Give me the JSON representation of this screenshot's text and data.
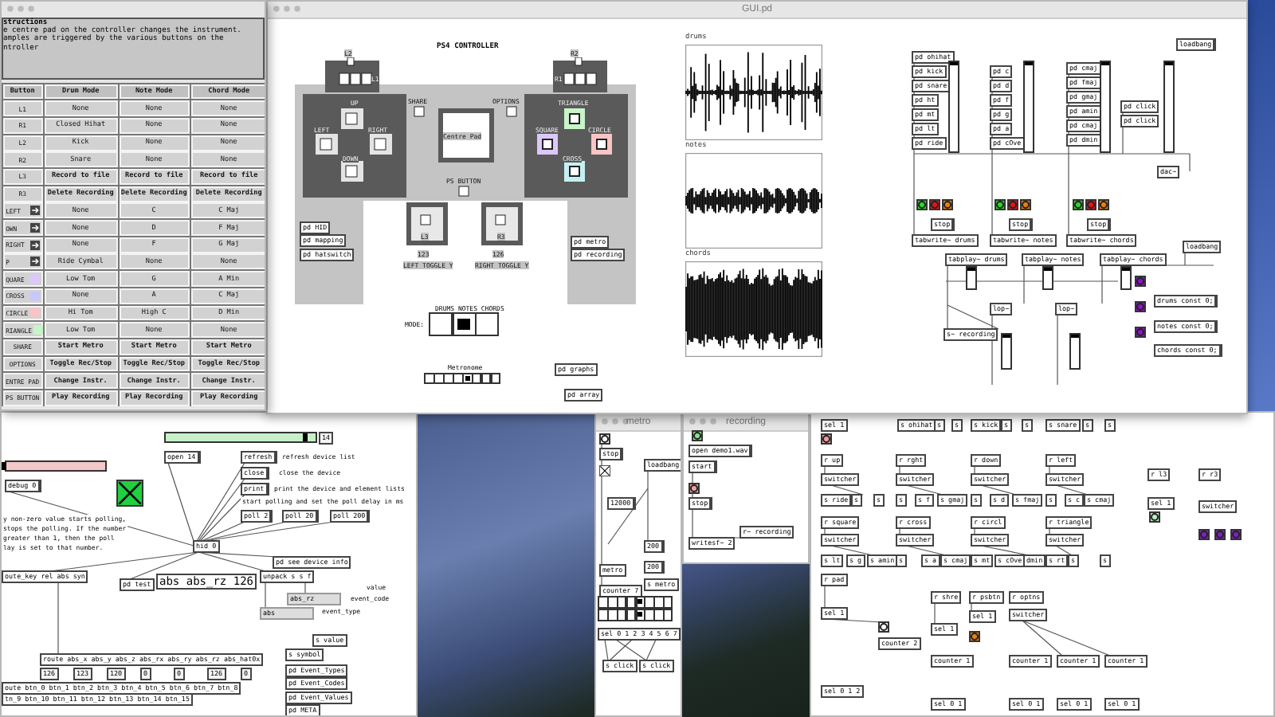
{
  "instructions": {
    "title": "structions",
    "text": [
      "e centre pad on the controller changes the instrument.",
      "amples are triggered by the various buttons on the",
      "ntroller"
    ],
    "columns": [
      "Button",
      "Drum Mode",
      "Note Mode",
      "Chord Mode"
    ],
    "rows": [
      {
        "kind": "plain",
        "bold": false,
        "cells": [
          "L1",
          "None",
          "None",
          "None"
        ]
      },
      {
        "kind": "plain",
        "bold": false,
        "cells": [
          "R1",
          "Closed Hihat",
          "None",
          "None"
        ]
      },
      {
        "kind": "plain",
        "bold": false,
        "cells": [
          "L2",
          "Kick",
          "None",
          "None"
        ]
      },
      {
        "kind": "plain",
        "bold": false,
        "cells": [
          "R2",
          "Snare",
          "None",
          "None"
        ]
      },
      {
        "kind": "plain",
        "bold": true,
        "cells": [
          "L3",
          "Record to file",
          "Record to file",
          "Record to file"
        ]
      },
      {
        "kind": "plain",
        "bold": true,
        "cells": [
          "R3",
          "Delete Recording",
          "Delete Recording",
          "Delete Recording"
        ]
      },
      {
        "kind": "arrow",
        "bold": false,
        "cells": [
          "LEFT",
          "None",
          "C",
          "C Maj"
        ]
      },
      {
        "kind": "arrow",
        "bold": false,
        "cells": [
          "OWN",
          "None",
          "D",
          "F Maj"
        ]
      },
      {
        "kind": "arrow",
        "bold": false,
        "cells": [
          "RIGHT",
          "None",
          "F",
          "G Maj"
        ]
      },
      {
        "kind": "arrow",
        "bold": false,
        "cells": [
          "P",
          "Ride Cymbal",
          "None",
          "None"
        ]
      },
      {
        "kind": "swatch",
        "color": "#dcc8f8",
        "bold": false,
        "cells": [
          "QUARE",
          "Low Tom",
          "G",
          "A Min"
        ]
      },
      {
        "kind": "swatch",
        "color": "#c8c8f8",
        "bold": false,
        "cells": [
          "CROSS",
          "None",
          "A",
          "C Maj"
        ]
      },
      {
        "kind": "swatch",
        "color": "#f8c4c4",
        "bold": false,
        "cells": [
          "CIRCLE",
          "Hi Tom",
          "High C",
          "D Min"
        ]
      },
      {
        "kind": "swatch",
        "color": "#c8f4c8",
        "bold": false,
        "cells": [
          "RIANGLE",
          "Low Tom",
          "None",
          "None"
        ]
      },
      {
        "kind": "plain",
        "bold": true,
        "cells": [
          "SHARE",
          "Start Metro",
          "Start Metro",
          "Start Metro"
        ]
      },
      {
        "kind": "plain",
        "bold": true,
        "cells": [
          "OPTIONS",
          "Toggle Rec/Stop",
          "Toggle Rec/Stop",
          "Toggle Rec/Stop"
        ]
      },
      {
        "kind": "plain",
        "bold": true,
        "cells": [
          "ENTRE PAD",
          "Change Instr.",
          "Change Instr.",
          "Change Instr."
        ]
      },
      {
        "kind": "plain",
        "bold": true,
        "cells": [
          "PS BUTTON",
          "Play Recording",
          "Play Recording",
          "Play Recording"
        ]
      }
    ]
  },
  "gui_window": {
    "title": "GUI.pd",
    "controller": {
      "title": "PS4 CONTROLLER",
      "labels": [
        "L2",
        "L1",
        "R2",
        "R1",
        "UP",
        "LEFT",
        "RIGHT",
        "DOWN",
        "SHARE",
        "OPTIONS",
        "Centre Pad",
        "TRIANGLE",
        "SQUARE",
        "CIRCLE",
        "CROSS",
        "PS BUTTON",
        "L3",
        "R3",
        "123",
        "LEFT TOGGLE Y",
        "126",
        "RIGHT TOGGLE Y"
      ],
      "face_buttons": [
        {
          "color": "#c8f4c8"
        },
        {
          "color": "#dcc8f8"
        },
        {
          "color": "#f8c4c4"
        },
        {
          "color": "#c4f0f4"
        }
      ]
    },
    "arrays": [
      {
        "kind": "drums",
        "label": "drums"
      },
      {
        "kind": "notes",
        "label": "notes"
      },
      {
        "kind": "chords",
        "label": "chords"
      }
    ],
    "objects": [
      {
        "kind": "obj",
        "text": "pd HID"
      },
      {
        "kind": "obj",
        "text": "pd mapping"
      },
      {
        "kind": "obj",
        "text": "pd hatswitch"
      },
      {
        "kind": "obj",
        "text": "pd metro"
      },
      {
        "kind": "obj",
        "text": "pd recording"
      },
      {
        "kind": "obj",
        "text": "pd graphs"
      },
      {
        "kind": "obj",
        "text": "pd array"
      },
      {
        "kind": "cmt",
        "text": "DRUMS NOTES CHORDS"
      },
      {
        "kind": "cmt",
        "text": "MODE:"
      },
      {
        "kind": "radio",
        "options": [
          {
            "selected": false
          },
          {
            "selected": true
          },
          {
            "selected": false
          }
        ]
      },
      {
        "kind": "cmt",
        "text": "Metronome"
      },
      {
        "kind": "radio",
        "options": [
          {
            "selected": false
          },
          {
            "selected": false
          },
          {
            "selected": false
          },
          {
            "selected": false
          },
          {
            "selected": true
          },
          {
            "selected": false
          },
          {
            "selected": false
          },
          {
            "selected": false
          }
        ]
      },
      {
        "kind": "obj",
        "text": "pd ohihat"
      },
      {
        "kind": "obj",
        "text": "pd kick"
      },
      {
        "kind": "obj",
        "text": "pd snare"
      },
      {
        "kind": "obj",
        "text": "pd ht"
      },
      {
        "kind": "obj",
        "text": "pd mt"
      },
      {
        "kind": "obj",
        "text": "pd lt"
      },
      {
        "kind": "obj",
        "text": "pd ride"
      },
      {
        "kind": "obj",
        "text": "pd c"
      },
      {
        "kind": "obj",
        "text": "pd d"
      },
      {
        "kind": "obj",
        "text": "pd f"
      },
      {
        "kind": "obj",
        "text": "pd g"
      },
      {
        "kind": "obj",
        "text": "pd a"
      },
      {
        "kind": "obj",
        "text": "pd cOve"
      },
      {
        "kind": "obj",
        "text": "pd cmaj"
      },
      {
        "kind": "obj",
        "text": "pd fmaj"
      },
      {
        "kind": "obj",
        "text": "pd gmaj"
      },
      {
        "kind": "obj",
        "text": "pd amin"
      },
      {
        "kind": "obj",
        "text": "pd cmaj"
      },
      {
        "kind": "obj",
        "text": "pd dmin"
      },
      {
        "kind": "obj",
        "text": "pd click"
      },
      {
        "kind": "obj",
        "text": "pd click"
      },
      {
        "kind": "msg",
        "text": "loadbang"
      },
      {
        "kind": "obj",
        "text": "dac~"
      },
      {
        "kind": "msg",
        "text": "stop"
      },
      {
        "kind": "msg",
        "text": "stop"
      },
      {
        "kind": "msg",
        "text": "stop"
      },
      {
        "kind": "obj",
        "text": "tabwrite~ drums"
      },
      {
        "kind": "obj",
        "text": "tabwrite~ notes"
      },
      {
        "kind": "obj",
        "text": "tabwrite~ chords"
      },
      {
        "kind": "obj",
        "text": "loadbang"
      },
      {
        "kind": "obj",
        "text": "tabplay~ drums"
      },
      {
        "kind": "obj",
        "text": "tabplay~ notes"
      },
      {
        "kind": "obj",
        "text": "tabplay~ chords"
      },
      {
        "kind": "obj",
        "text": "lop~"
      },
      {
        "kind": "obj",
        "text": "lop~"
      },
      {
        "kind": "obj",
        "text": "s~ recording"
      },
      {
        "kind": "msg",
        "text": "drums const 0;"
      },
      {
        "kind": "msg",
        "text": "notes const 0;"
      },
      {
        "kind": "msg",
        "text": "chords const 0;"
      },
      {
        "kind": "bang",
        "color": "#20e020"
      },
      {
        "kind": "bang",
        "color": "#f01010"
      },
      {
        "kind": "bang",
        "color": "#f08000"
      },
      {
        "kind": "bang",
        "color": "#20e020"
      },
      {
        "kind": "bang",
        "color": "#f01010"
      },
      {
        "kind": "bang",
        "color": "#f08000"
      },
      {
        "kind": "bang",
        "color": "#20e020"
      },
      {
        "kind": "bang",
        "color": "#f01010"
      },
      {
        "kind": "bang",
        "color": "#f08000"
      },
      {
        "kind": "bang",
        "color": "#9010d0"
      },
      {
        "kind": "bang",
        "color": "#9010d0"
      },
      {
        "kind": "bang",
        "color": "#9010d0"
      },
      {
        "kind": "vslider",
        "level": 1
      },
      {
        "kind": "vslider",
        "level": 1
      },
      {
        "kind": "vslider",
        "level": 1
      },
      {
        "kind": "vslider",
        "level": 1
      },
      {
        "kind": "vslider",
        "level": 1
      },
      {
        "kind": "vslider",
        "level": 1
      },
      {
        "kind": "vslider",
        "level": 1
      },
      {
        "kind": "vslider",
        "level": 1
      },
      {
        "kind": "vslider",
        "level": 1
      }
    ]
  },
  "hid_patch": {
    "objects": [
      {
        "kind": "hslider",
        "color": "#c8f0c8",
        "level": 0.95
      },
      {
        "kind": "num",
        "text": "14"
      },
      {
        "kind": "msg",
        "text": "open 14"
      },
      {
        "kind": "msg",
        "text": "refresh"
      },
      {
        "kind": "cmt",
        "text": "refresh device list"
      },
      {
        "kind": "msg",
        "text": "close"
      },
      {
        "kind": "cmt",
        "text": "close the device"
      },
      {
        "kind": "msg",
        "text": "print"
      },
      {
        "kind": "cmt",
        "text": "print the device and element lists"
      },
      {
        "kind": "cmt",
        "text": "start polling and set the poll delay in ms"
      },
      {
        "kind": "msg",
        "text": "poll 2"
      },
      {
        "kind": "msg",
        "text": "poll 20"
      },
      {
        "kind": "msg",
        "text": "poll 200"
      },
      {
        "kind": "hslider",
        "color": "#f4c8c8",
        "level": 0
      },
      {
        "kind": "msg",
        "text": "debug 0"
      },
      {
        "kind": "toggle",
        "checked": true
      },
      {
        "kind": "cmt",
        "text": "y non-zero value starts polling,"
      },
      {
        "kind": "cmt",
        "text": "stops the polling. If the number"
      },
      {
        "kind": "cmt",
        "text": "greater than 1, then the poll"
      },
      {
        "kind": "cmt",
        "text": "lay is set to that number."
      },
      {
        "kind": "obj",
        "text": "hid 0"
      },
      {
        "kind": "obj",
        "text": "pd see device info"
      },
      {
        "kind": "obj",
        "text": "oute_key rel abs syn"
      },
      {
        "kind": "obj",
        "text": "pd test"
      },
      {
        "kind": "big",
        "text": "abs abs_rz 126"
      },
      {
        "kind": "obj",
        "text": "unpack s s f"
      },
      {
        "kind": "sym",
        "text": "abs_rz"
      },
      {
        "kind": "cmt",
        "text": "value"
      },
      {
        "kind": "cmt",
        "text": "event_code"
      },
      {
        "kind": "sym",
        "text": "abs"
      },
      {
        "kind": "cmt",
        "text": "event_type"
      },
      {
        "kind": "obj",
        "text": "s value"
      },
      {
        "kind": "obj",
        "text": "s symbol"
      },
      {
        "kind": "obj",
        "text": "pd Event_Types"
      },
      {
        "kind": "obj",
        "text": "pd Event_Codes"
      },
      {
        "kind": "obj",
        "text": "pd Event_Values"
      },
      {
        "kind": "obj",
        "text": "pd META"
      },
      {
        "kind": "obj",
        "text": "route abs_x abs_y abs_z abs_rx abs_ry abs_rz abs_hat0x"
      },
      {
        "kind": "num",
        "text": "126"
      },
      {
        "kind": "num",
        "text": "123"
      },
      {
        "kind": "num",
        "text": "120"
      },
      {
        "kind": "num",
        "text": "0"
      },
      {
        "kind": "num",
        "text": "0"
      },
      {
        "kind": "num",
        "text": "126"
      },
      {
        "kind": "num",
        "text": "0"
      },
      {
        "kind": "obj",
        "text": "oute btn_0 btn_1 btn_2 btn_3 btn_4 btn_5 btn_6 btn_7 btn_8"
      },
      {
        "kind": "obj",
        "text": "tn_9 btn_10 btn_11 btn_12 btn_13 btn_14 btn_15"
      }
    ]
  },
  "metro_window": {
    "title": "metro",
    "objects": [
      {
        "kind": "bang"
      },
      {
        "kind": "msg",
        "text": "stop"
      },
      {
        "kind": "toggle",
        "checked": true
      },
      {
        "kind": "obj",
        "text": "loadbang"
      },
      {
        "kind": "msg",
        "text": "12000"
      },
      {
        "kind": "msg",
        "text": "200"
      },
      {
        "kind": "msg",
        "text": "200"
      },
      {
        "kind": "obj",
        "text": "metro"
      },
      {
        "kind": "obj",
        "text": "s metro"
      },
      {
        "kind": "obj",
        "text": "counter 7"
      },
      {
        "kind": "radio",
        "options": [
          {
            "selected": false
          },
          {
            "selected": false
          },
          {
            "selected": false
          },
          {
            "selected": false
          },
          {
            "selected": true
          },
          {
            "selected": false
          },
          {
            "selected": false
          },
          {
            "selected": false
          }
        ]
      },
      {
        "kind": "radio",
        "options": [
          {
            "selected": false
          },
          {
            "selected": false
          },
          {
            "selected": false
          },
          {
            "selected": false
          },
          {
            "selected": true
          },
          {
            "selected": false
          },
          {
            "selected": false
          },
          {
            "selected": false
          }
        ]
      },
      {
        "kind": "obj",
        "text": "sel 0 1 2 3 4 5 6 7"
      },
      {
        "kind": "obj",
        "text": "s click"
      },
      {
        "kind": "obj",
        "text": "s click"
      }
    ]
  },
  "recording_window": {
    "title": "recording",
    "objects": [
      {
        "kind": "bang",
        "color": "#90e090"
      },
      {
        "kind": "msg",
        "text": "open demo1.wav"
      },
      {
        "kind": "msg",
        "text": "start"
      },
      {
        "kind": "bang",
        "color": "#f0a0a0"
      },
      {
        "kind": "msg",
        "text": "stop"
      },
      {
        "kind": "obj",
        "text": "r~ recording"
      },
      {
        "kind": "obj",
        "text": "writesf~ 2"
      }
    ]
  },
  "mapping_patch": {
    "objects": [
      {
        "kind": "obj",
        "text": "sel 1"
      },
      {
        "kind": "bang",
        "color": "#f0a0a0"
      },
      {
        "kind": "obj",
        "text": "s ohihat"
      },
      {
        "kind": "obj",
        "text": "s"
      },
      {
        "kind": "obj",
        "text": "s"
      },
      {
        "kind": "obj",
        "text": "s kick"
      },
      {
        "kind": "obj",
        "text": "s"
      },
      {
        "kind": "obj",
        "text": "s"
      },
      {
        "kind": "obj",
        "text": "s snare"
      },
      {
        "kind": "obj",
        "text": "s"
      },
      {
        "kind": "obj",
        "text": "s"
      },
      {
        "kind": "obj",
        "text": "r up"
      },
      {
        "kind": "obj",
        "text": "r rght"
      },
      {
        "kind": "obj",
        "text": "r down"
      },
      {
        "kind": "obj",
        "text": "r left"
      },
      {
        "kind": "obj",
        "text": "switcher"
      },
      {
        "kind": "obj",
        "text": "switcher"
      },
      {
        "kind": "obj",
        "text": "switcher"
      },
      {
        "kind": "obj",
        "text": "switcher"
      },
      {
        "kind": "obj",
        "text": "s ride"
      },
      {
        "kind": "obj",
        "text": "s"
      },
      {
        "kind": "obj",
        "text": "s"
      },
      {
        "kind": "obj",
        "text": "s"
      },
      {
        "kind": "obj",
        "text": "s f"
      },
      {
        "kind": "obj",
        "text": "s gmaj"
      },
      {
        "kind": "obj",
        "text": "s"
      },
      {
        "kind": "obj",
        "text": "s d"
      },
      {
        "kind": "obj",
        "text": "s fmaj"
      },
      {
        "kind": "obj",
        "text": "s"
      },
      {
        "kind": "obj",
        "text": "s c"
      },
      {
        "kind": "obj",
        "text": "s cmaj"
      },
      {
        "kind": "obj",
        "text": "r square"
      },
      {
        "kind": "obj",
        "text": "r cross"
      },
      {
        "kind": "obj",
        "text": "r circl"
      },
      {
        "kind": "obj",
        "text": "r triangle"
      },
      {
        "kind": "obj",
        "text": "switcher"
      },
      {
        "kind": "obj",
        "text": "switcher"
      },
      {
        "kind": "obj",
        "text": "switcher"
      },
      {
        "kind": "obj",
        "text": "switcher"
      },
      {
        "kind": "obj",
        "text": "s lt"
      },
      {
        "kind": "obj",
        "text": "s g"
      },
      {
        "kind": "obj",
        "text": "s amin"
      },
      {
        "kind": "obj",
        "text": "s"
      },
      {
        "kind": "obj",
        "text": "s a"
      },
      {
        "kind": "obj",
        "text": "s cmaj"
      },
      {
        "kind": "obj",
        "text": "s mt"
      },
      {
        "kind": "obj",
        "text": "s cOve"
      },
      {
        "kind": "obj",
        "text": "dmin"
      },
      {
        "kind": "obj",
        "text": "s rt"
      },
      {
        "kind": "obj",
        "text": "s"
      },
      {
        "kind": "obj",
        "text": "s"
      },
      {
        "kind": "obj",
        "text": "r l3"
      },
      {
        "kind": "obj",
        "text": "sel 1"
      },
      {
        "kind": "bang",
        "color": "#b8f0c0"
      },
      {
        "kind": "obj",
        "text": "r r3"
      },
      {
        "kind": "obj",
        "text": "switcher"
      },
      {
        "kind": "bang",
        "color": "#8020c0"
      },
      {
        "kind": "bang",
        "color": "#8020c0"
      },
      {
        "kind": "bang",
        "color": "#8020c0"
      },
      {
        "kind": "obj",
        "text": "r pad"
      },
      {
        "kind": "obj",
        "text": "sel 1"
      },
      {
        "kind": "bang"
      },
      {
        "kind": "obj",
        "text": "counter 2"
      },
      {
        "kind": "obj",
        "text": "sel 0 1 2"
      },
      {
        "kind": "obj",
        "text": "r shre"
      },
      {
        "kind": "obj",
        "text": "sel 1"
      },
      {
        "kind": "obj",
        "text": "counter 1"
      },
      {
        "kind": "obj",
        "text": "sel 0 1"
      },
      {
        "kind": "obj",
        "text": "r psbtn"
      },
      {
        "kind": "obj",
        "text": "sel 1"
      },
      {
        "kind": "bang",
        "color": "#f08000"
      },
      {
        "kind": "obj",
        "text": "r optns"
      },
      {
        "kind": "obj",
        "text": "switcher"
      },
      {
        "kind": "obj",
        "text": "counter 1"
      },
      {
        "kind": "obj",
        "text": "counter 1"
      },
      {
        "kind": "obj",
        "text": "counter 1"
      },
      {
        "kind": "obj",
        "text": "sel 0 1"
      },
      {
        "kind": "obj",
        "text": "sel 0 1"
      },
      {
        "kind": "obj",
        "text": "sel 0 1"
      }
    ]
  }
}
